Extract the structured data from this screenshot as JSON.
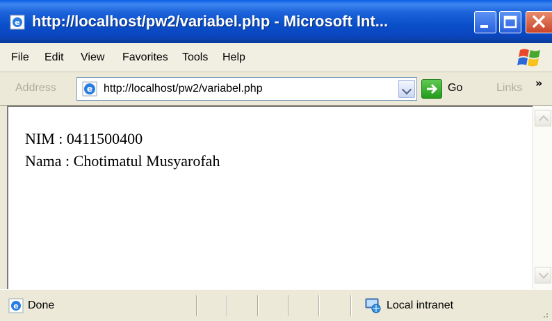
{
  "window": {
    "title": "http://localhost/pw2/variabel.php - Microsoft Int..."
  },
  "menu": {
    "items": [
      "File",
      "Edit",
      "View",
      "Favorites",
      "Tools",
      "Help"
    ]
  },
  "address_bar": {
    "label": "Address",
    "url": "http://localhost/pw2/variabel.php",
    "go_label": "Go",
    "links_label": "Links",
    "links_chevron": "»"
  },
  "content": {
    "line1": "NIM : 0411500400",
    "line2": "Nama : Chotimatul Musyarofah"
  },
  "status_bar": {
    "status": "Done",
    "zone": "Local intranet"
  },
  "colors": {
    "titlebar": "#0a4fc9",
    "chrome": "#ece9d8",
    "content_bg": "#ffffff"
  },
  "icons": [
    "ie-icon",
    "minimize-icon",
    "maximize-icon",
    "close-icon",
    "windows-logo-icon",
    "dropdown-chevron-icon",
    "go-arrow-icon",
    "scroll-up-icon",
    "scroll-down-icon",
    "intranet-icon",
    "resize-grip-icon"
  ]
}
